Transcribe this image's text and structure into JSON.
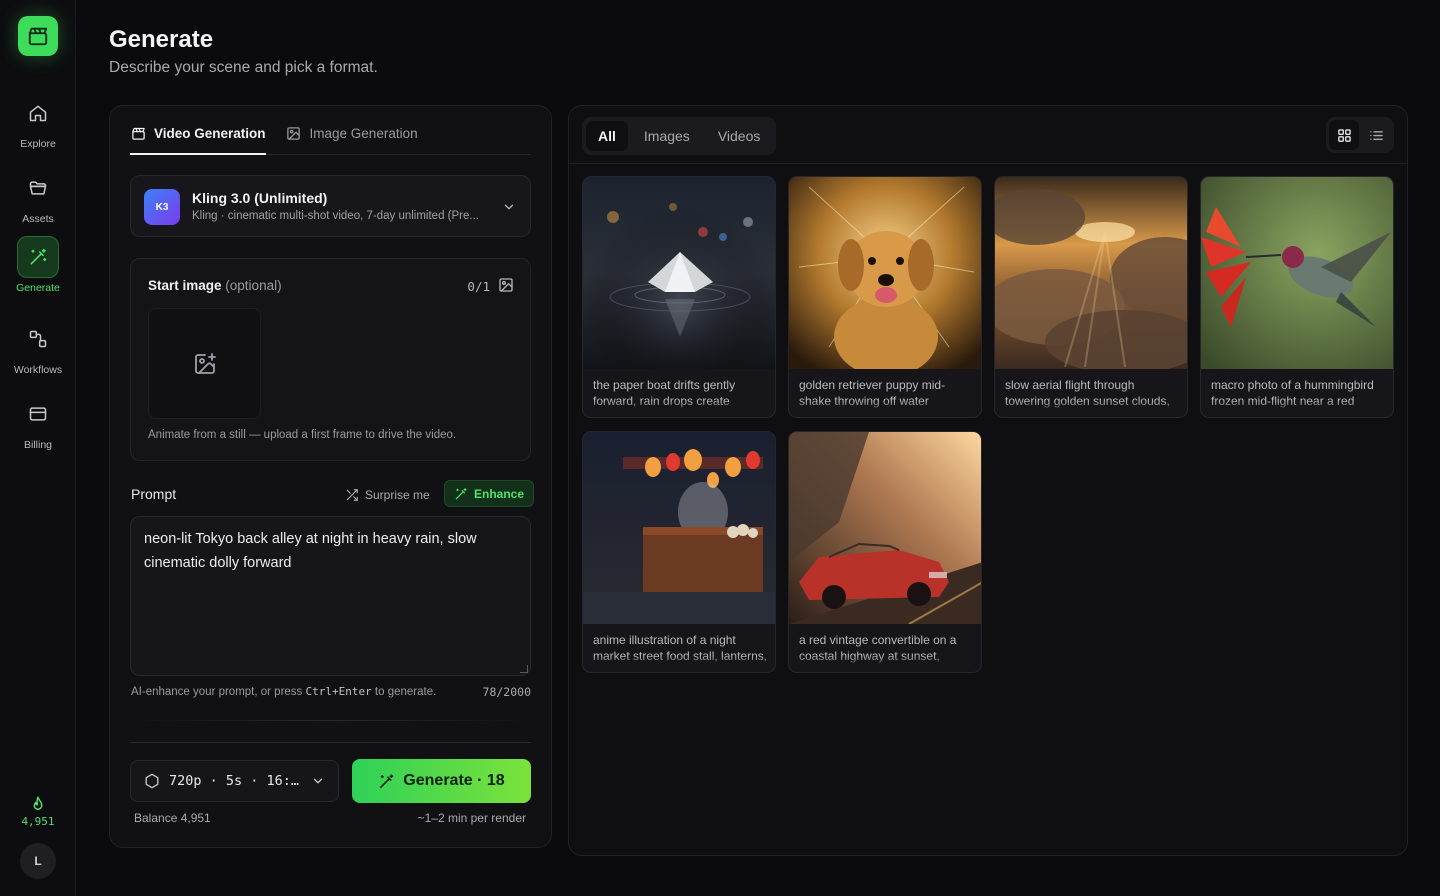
{
  "sidebar": {
    "items": [
      {
        "label": "Explore"
      },
      {
        "label": "Assets"
      },
      {
        "label": "Generate"
      },
      {
        "label": "Workflows"
      },
      {
        "label": "Billing"
      }
    ],
    "active": "Generate",
    "credits": "4,951",
    "avatar_initial": "L"
  },
  "header": {
    "title": "Generate",
    "subtitle": "Describe your scene and pick a format."
  },
  "generator": {
    "tabs": [
      {
        "label": "Video Generation",
        "active": true
      },
      {
        "label": "Image Generation",
        "active": false
      }
    ],
    "model": {
      "badge": "K3",
      "name": "Kling 3.0 (Unlimited)",
      "description": "Kling · cinematic multi-shot video, 7-day unlimited (Pre..."
    },
    "start_image": {
      "label": "Start image",
      "optional": "(optional)",
      "count": "0/1",
      "help": "Animate from a still — upload a first frame to drive the video."
    },
    "prompt": {
      "label": "Prompt",
      "surprise_label": "Surprise me",
      "enhance_label": "Enhance",
      "value": "neon-lit Tokyo back alley at night in heavy rain, slow cinematic dolly forward",
      "help_prefix": "AI-enhance your prompt, or press ",
      "help_kbd": "Ctrl+Enter",
      "help_suffix": " to generate.",
      "count": "78/2000"
    },
    "settings_summary": "720p · 5s · 16:…",
    "generate_label": "Generate · 18",
    "balance": "Balance 4,951",
    "render_time": "~1–2 min per render"
  },
  "gallery": {
    "filters": [
      {
        "label": "All",
        "active": true
      },
      {
        "label": "Images",
        "active": false
      },
      {
        "label": "Videos",
        "active": false
      }
    ],
    "view_modes": [
      "grid-icon",
      "list-icon"
    ],
    "active_view": "grid",
    "items": [
      {
        "caption": "the paper boat drifts gently forward, rain drops create expanding ripples, bokeh city"
      },
      {
        "caption": "golden retriever puppy mid-shake throwing off water droplets, backlit by low sun"
      },
      {
        "caption": "slow aerial flight through towering golden sunset clouds, god rays, birds in the far"
      },
      {
        "caption": "macro photo of a hummingbird frozen mid-flight near a red flower"
      },
      {
        "caption": "anime illustration of a night market street food stall, lanterns, rain"
      },
      {
        "caption": "a red vintage convertible on a coastal highway at sunset, cinematic"
      }
    ]
  },
  "colors": {
    "accent": "#3ddc5a",
    "background": "#0b0b0d",
    "panel": "#111114"
  }
}
